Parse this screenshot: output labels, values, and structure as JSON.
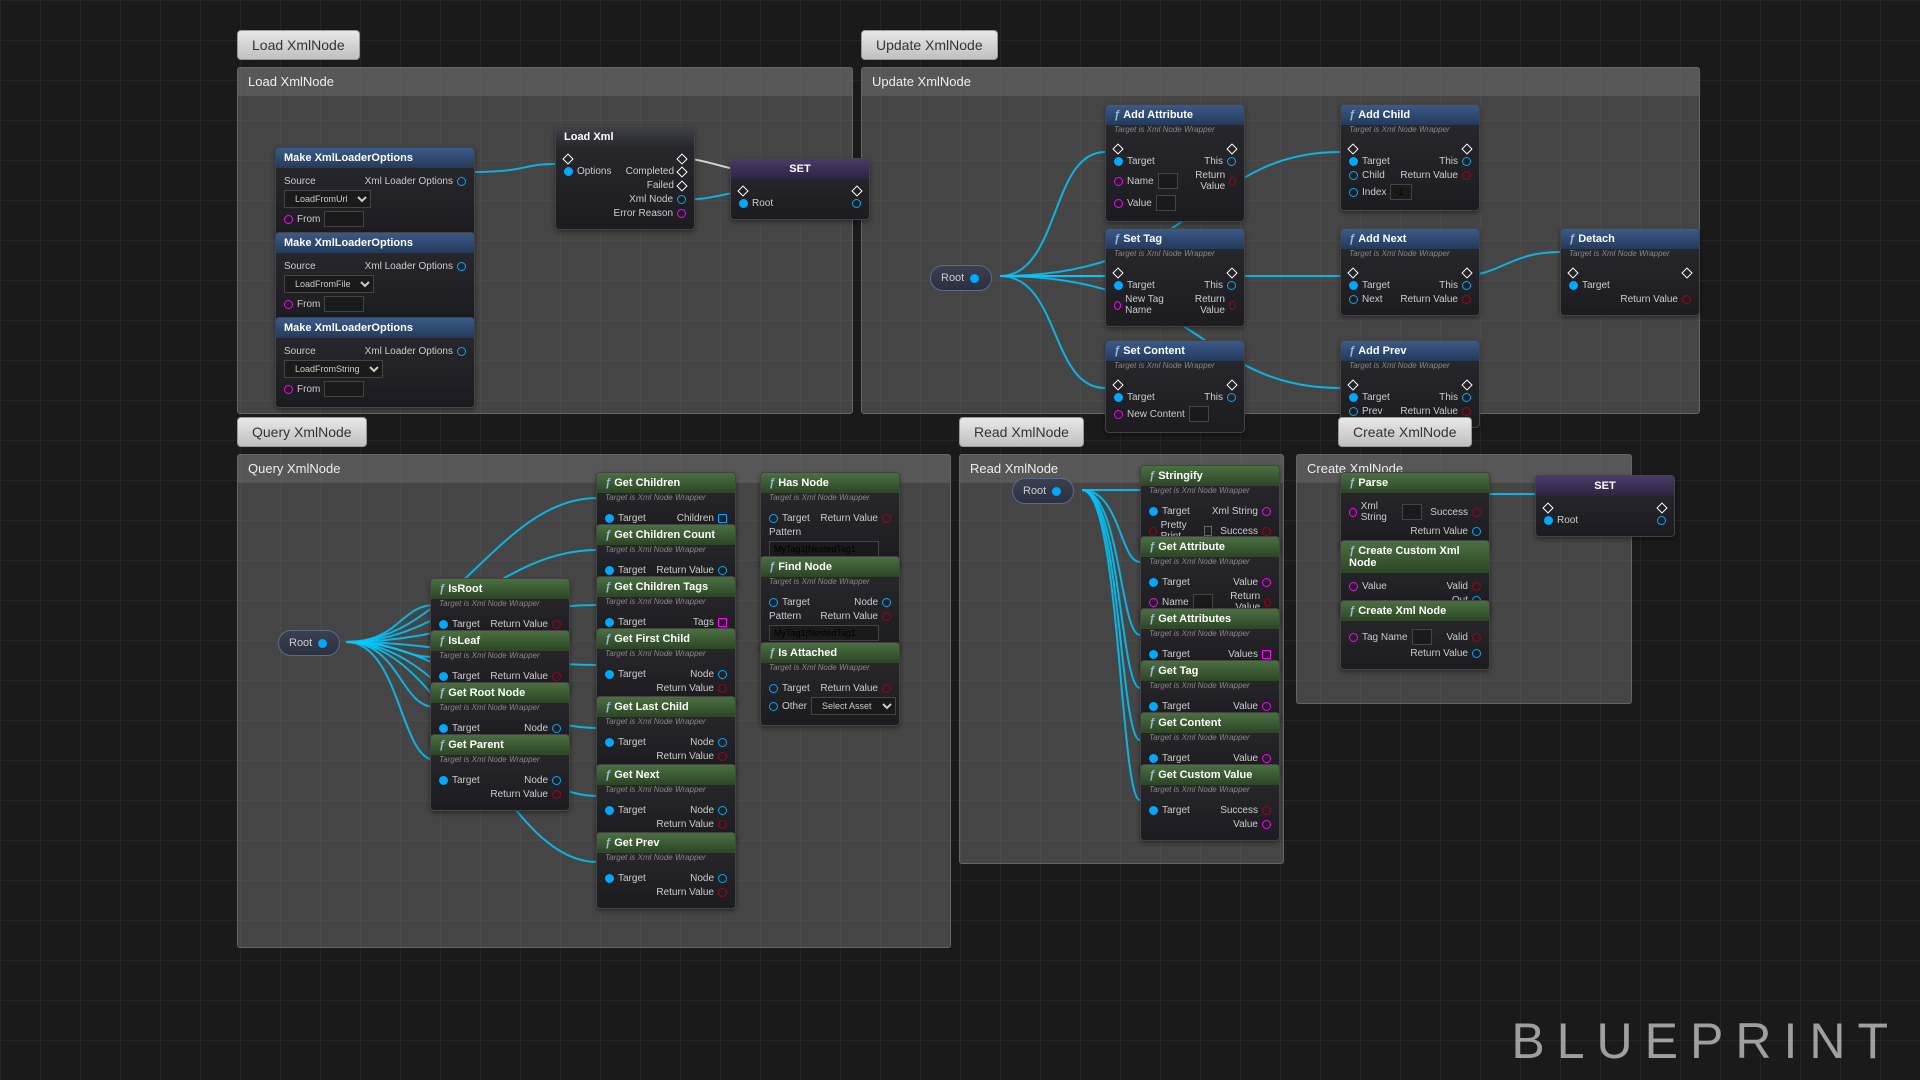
{
  "watermark": "BLUEPRINT",
  "tabs": {
    "load": "Load XmlNode",
    "update": "Update XmlNode",
    "query": "Query XmlNode",
    "read": "Read XmlNode",
    "create": "Create XmlNode"
  },
  "headers": {
    "load": "Load XmlNode",
    "update": "Update XmlNode",
    "query": "Query XmlNode",
    "read": "Read XmlNode",
    "create": "Create XmlNode"
  },
  "common": {
    "root": "Root",
    "target": "Target",
    "return": "Return Value",
    "this": "This",
    "set": "SET",
    "target_sub": "Target is Xml Node Wrapper"
  },
  "load": {
    "makeOpts": "Make XmlLoaderOptions",
    "source": "Source",
    "from": "From",
    "xmlLoaderOptions": "Xml Loader Options",
    "opt1": "LoadFromUrl",
    "opt2": "LoadFromFile",
    "opt3": "LoadFromString",
    "loadXml": "Load Xml",
    "options": "Options",
    "completed": "Completed",
    "failed": "Failed",
    "xmlNode": "Xml Node",
    "errorReason": "Error Reason"
  },
  "update": {
    "addAttr": "Add Attribute",
    "name": "Name",
    "value": "Value",
    "addChild": "Add Child",
    "child": "Child",
    "index": "Index",
    "idx_val": "-1",
    "setTag": "Set Tag",
    "newTagName": "New Tag Name",
    "addNext": "Add Next",
    "next": "Next",
    "detach": "Detach",
    "setContent": "Set Content",
    "newContent": "New Content",
    "addPrev": "Add Prev",
    "prev": "Prev"
  },
  "query": {
    "isRoot": "IsRoot",
    "isLeaf": "IsLeaf",
    "getRootNode": "Get Root Node",
    "getParent": "Get Parent",
    "node": "Node",
    "getChildren": "Get Children",
    "children": "Children",
    "getChildrenCount": "Get Children Count",
    "getChildrenTags": "Get Children Tags",
    "tags": "Tags",
    "getFirstChild": "Get First Child",
    "getLastChild": "Get Last Child",
    "getNext": "Get Next",
    "getPrev": "Get Prev",
    "hasNode": "Has Node",
    "pattern": "Pattern",
    "pattern_val": "MyTag1|NestedTag1",
    "findNode": "Find Node",
    "isAttached": "Is Attached",
    "other": "Other",
    "selectAsset": "Select Asset"
  },
  "read": {
    "stringify": "Stringify",
    "xmlString": "Xml String",
    "prettyPrint": "Pretty Print",
    "success": "Success",
    "getAttr": "Get Attribute",
    "value": "Value",
    "name": "Name",
    "getAttrs": "Get Attributes",
    "values": "Values",
    "getTag": "Get Tag",
    "getContent": "Get Content",
    "getCustom": "Get Custom Value"
  },
  "create": {
    "parse": "Parse",
    "xmlString": "Xml String",
    "success": "Success",
    "return": "Return Value",
    "createCustom": "Create Custom Xml Node",
    "value": "Value",
    "valid": "Valid",
    "out": "Out",
    "createXml": "Create Xml Node",
    "tagName": "Tag Name"
  }
}
